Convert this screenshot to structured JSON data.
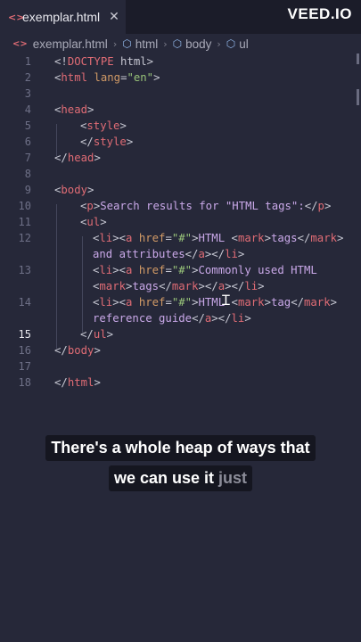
{
  "tab": {
    "icon": "code-icon",
    "title": "exemplar.html",
    "close": "✕"
  },
  "watermark": "VEED.IO",
  "breadcrumb": {
    "file": "exemplar.html",
    "items": [
      "html",
      "body",
      "ul"
    ]
  },
  "active_line": 15,
  "lines": [
    {
      "n": "1"
    },
    {
      "n": "2"
    },
    {
      "n": "3"
    },
    {
      "n": "4"
    },
    {
      "n": "5"
    },
    {
      "n": "6"
    },
    {
      "n": "7"
    },
    {
      "n": "8"
    },
    {
      "n": "9"
    },
    {
      "n": "10"
    },
    {
      "n": "11"
    },
    {
      "n": "12"
    },
    {
      "n": "13"
    },
    {
      "n": "14"
    },
    {
      "n": "15"
    },
    {
      "n": "16"
    },
    {
      "n": "17"
    },
    {
      "n": "18"
    }
  ],
  "code": {
    "l1": {
      "open": "<!",
      "tag": "DOCTYPE",
      "rest": " html",
      "close": ">"
    },
    "l2": {
      "open": "<",
      "tag": "html",
      "attr": " lang",
      "eq": "=",
      "val": "\"en\"",
      "close": ">"
    },
    "l4": {
      "open": "<",
      "tag": "head",
      "close": ">"
    },
    "l5": {
      "open": "<",
      "tag": "style",
      "close": ">"
    },
    "l6": {
      "open": "</",
      "tag": "style",
      "close": ">"
    },
    "l7": {
      "open": "</",
      "tag": "head",
      "close": ">"
    },
    "l9": {
      "open": "<",
      "tag": "body",
      "close": ">"
    },
    "l10": {
      "open": "<",
      "tag": "p",
      "close": ">",
      "text": "Search results for \"HTML tags\":",
      "open2": "</",
      "tag2": "p",
      "close2": ">"
    },
    "l11": {
      "open": "<",
      "tag": "ul",
      "close": ">"
    },
    "l12a": {
      "li": "li",
      "a": "a",
      "href": " href",
      "eq": "=",
      "val": "\"#\"",
      "text1": "HTML ",
      "mark": "mark",
      "text2": "tags",
      "mark2": "mark"
    },
    "l12b": {
      "text": "and attributes",
      "a": "a",
      "li": "li"
    },
    "l13a": {
      "li": "li",
      "a": "a",
      "href": " href",
      "eq": "=",
      "val": "\"#\"",
      "text1": "Commonly used HTML"
    },
    "l13b": {
      "mark": "mark",
      "text": "tags",
      "mark2": "mark",
      "a": "a",
      "li": "li"
    },
    "l14a": {
      "li": "li",
      "a": "a",
      "href": " href",
      "eq": "=",
      "val": "\"#\"",
      "text1": "HTML ",
      "mark": "mark",
      "text2": "tag",
      "mark2": "mark"
    },
    "l14b": {
      "text": "reference guide",
      "a": "a",
      "li": "li"
    },
    "l15": {
      "open": "</",
      "tag": "ul",
      "close": ">"
    },
    "l16": {
      "open": "</",
      "tag": "body",
      "close": ">"
    },
    "l18": {
      "open": "</",
      "tag": "html",
      "close": ">"
    }
  },
  "caption": {
    "line1": "There's a whole heap of ways that",
    "line2_main": "we can use it ",
    "line2_dim": "just"
  }
}
